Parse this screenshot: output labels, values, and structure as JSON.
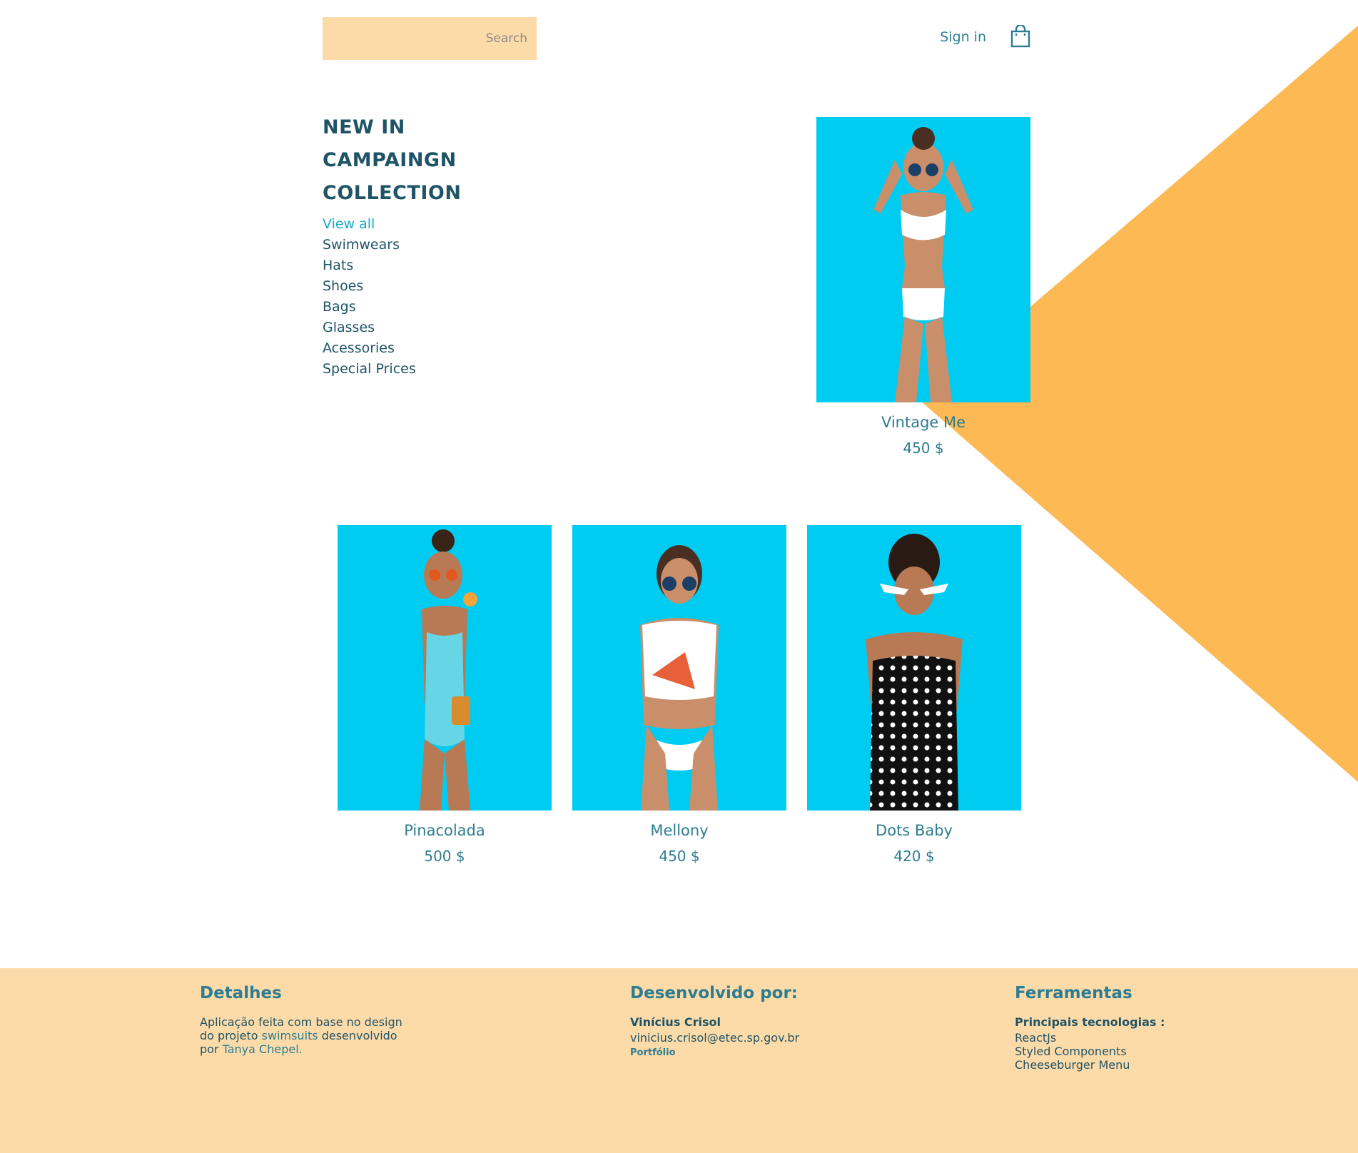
{
  "colors": {
    "accent": "#2d7d92",
    "dark": "#1f5467",
    "orange": "#fcb954",
    "peach": "#fddba9",
    "photo_bg": "#00ccf2",
    "active_link": "#17a9c8"
  },
  "header": {
    "search_placeholder": "Search",
    "signin_label": "Sign in",
    "bag_icon": "shopping-bag-icon"
  },
  "menu": {
    "headings": [
      "NEW IN",
      "CAMPAINGN",
      "COLLECTION"
    ],
    "items": [
      "View all",
      "Swimwears",
      "Hats",
      "Shoes",
      "Bags",
      "Glasses",
      "Acessories",
      "Special Prices"
    ]
  },
  "products": [
    {
      "name": "Vintage Me",
      "price": "450 $"
    },
    {
      "name": "Pinacolada",
      "price": "500 $"
    },
    {
      "name": "Mellony",
      "price": "450 $"
    },
    {
      "name": "Dots Baby",
      "price": "420 $"
    }
  ],
  "footer": {
    "details": {
      "title": "Detalhes",
      "text_1": "Aplicação feita com base no design",
      "text_2": "do projeto ",
      "link_project": "swimsuits",
      "text_3": " desenvolvido",
      "text_4": "por ",
      "link_author": "Tanya Chepel."
    },
    "developer": {
      "title": "Desenvolvido por:",
      "name": "Vinícius Crisol",
      "email": "vinicius.crisol@etec.sp.gov.br",
      "portfolio": "Portfólio"
    },
    "tools": {
      "title": "Ferramentas",
      "subtitle": "Principais tecnologias :",
      "items": [
        "ReactJs",
        "Styled Components",
        "Cheeseburger Menu"
      ]
    }
  }
}
